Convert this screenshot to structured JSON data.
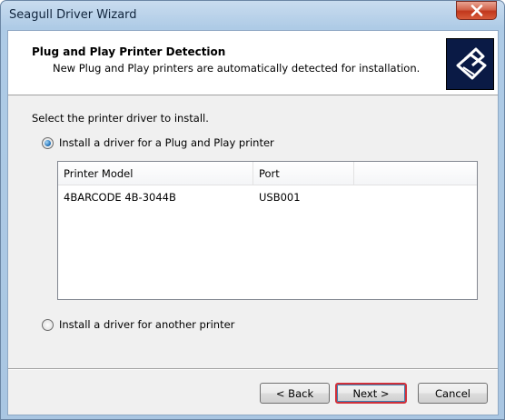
{
  "window": {
    "title": "Seagull Driver Wizard",
    "close_glyph": "✕"
  },
  "header": {
    "title": "Plug and Play Printer Detection",
    "subtitle": "New Plug and Play printers are automatically detected for installation.",
    "logo_icon": "printer-logo-icon"
  },
  "main": {
    "prompt": "Select the printer driver to install.",
    "option_pnp": {
      "label": "Install a driver for a Plug and Play printer",
      "checked": true
    },
    "option_other": {
      "label": "Install a driver for another printer",
      "checked": false
    },
    "table": {
      "columns": [
        "Printer Model",
        "Port"
      ],
      "rows": [
        {
          "model": "4BARCODE 4B-3044B",
          "port": "USB001"
        }
      ]
    }
  },
  "buttons": {
    "back": "< Back",
    "next": "Next >",
    "cancel": "Cancel"
  },
  "colors": {
    "close_red": "#c1371c",
    "logo_navy": "#0a1a45",
    "focus_red": "#d0303a"
  }
}
